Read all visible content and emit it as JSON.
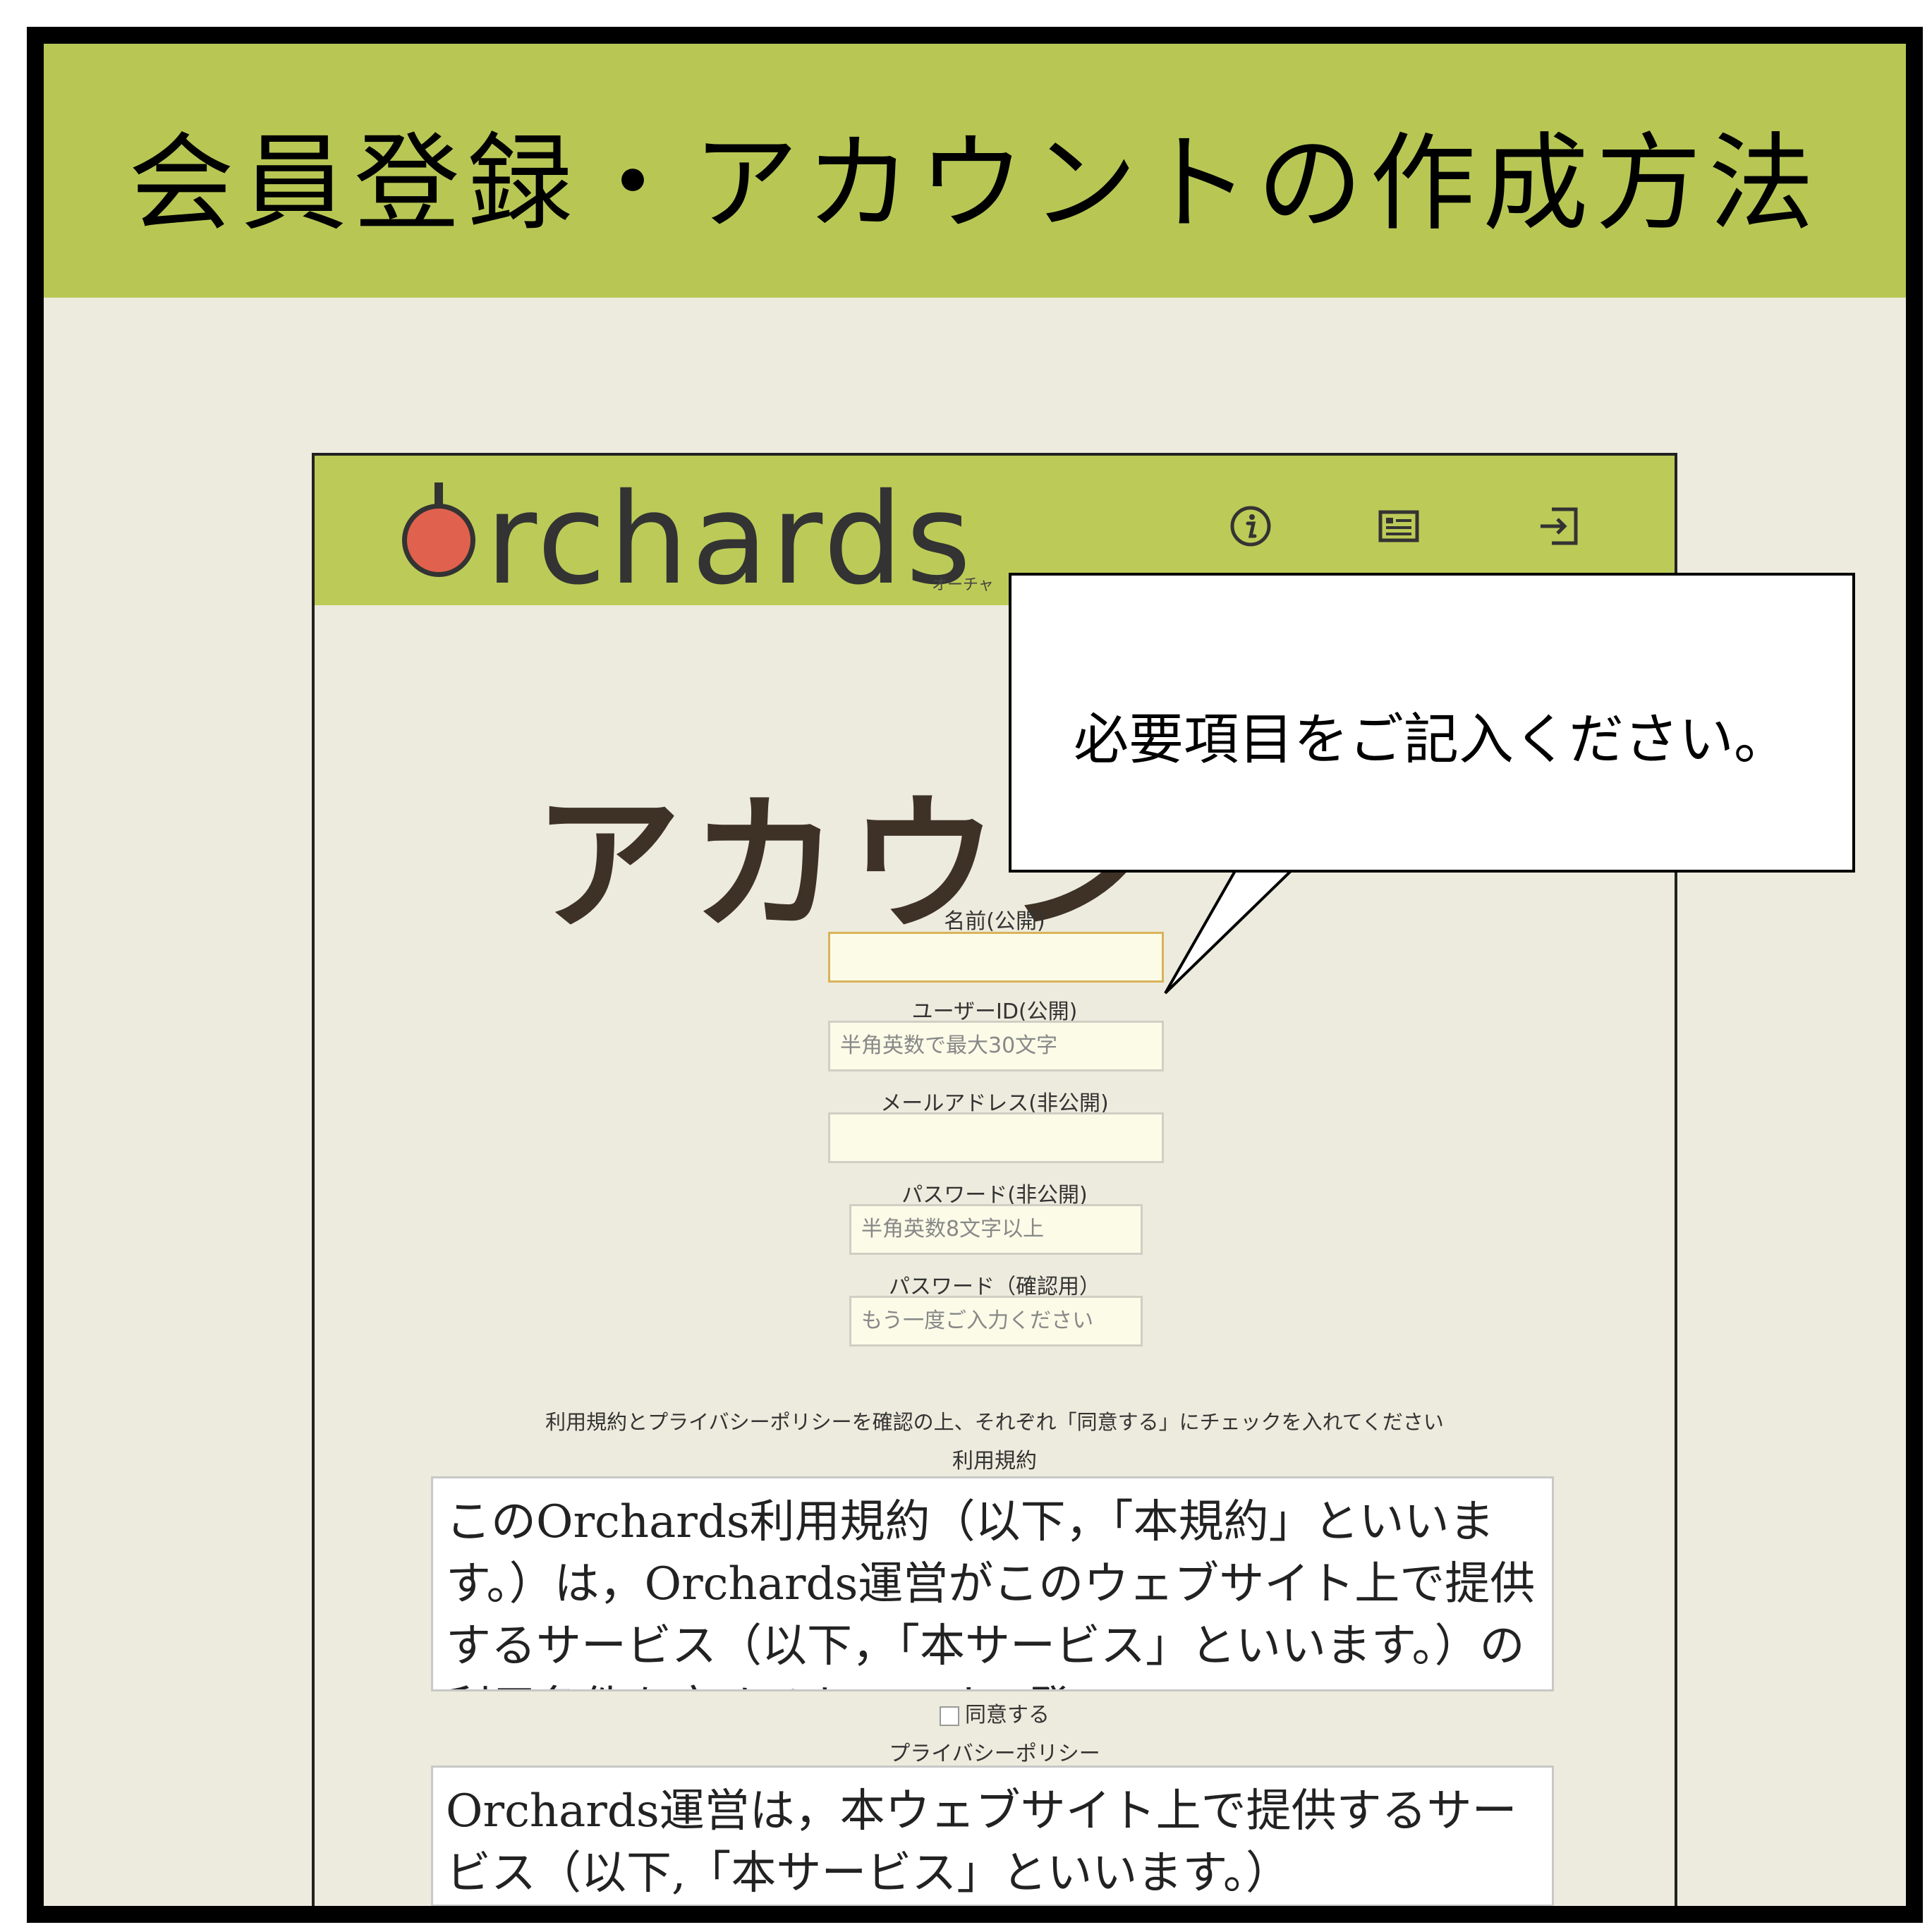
{
  "heading": "会員登録・アカウントの作成方法",
  "header": {
    "logo_text": "rchards",
    "tagline": "オーチャ",
    "icons": [
      "info-icon",
      "list-icon",
      "login-icon"
    ]
  },
  "page_title": "アカウン",
  "form": {
    "name_label": "名前(公開)",
    "name_value": "",
    "userid_label": "ユーザーID(公開)",
    "userid_placeholder": "半角英数で最大30文字",
    "email_label": "メールアドレス(非公開)",
    "email_value": "",
    "password_label": "パスワード(非公開)",
    "password_placeholder": "半角英数8文字以上",
    "password_confirm_label": "パスワード（確認用）",
    "password_confirm_placeholder": "もう一度ご入力ください"
  },
  "notice": "利用規約とプライバシーポリシーを確認の上、それぞれ「同意する」にチェックを入れてください",
  "terms": {
    "label": "利用規約",
    "text": "このOrchards利用規約（以下，「本規約」といいます。）は，Orchards運営がこのウェブサイト上で提供するサービス（以下，「本サービス」といいます。）の利用条件を定めるものです。登",
    "agree_label": "同意する"
  },
  "privacy": {
    "label": "プライバシーポリシー",
    "text": "Orchards運営は，本ウェブサイト上で提供するサービス（以下,「本サービス」といいます。）"
  },
  "callout": {
    "text": "必要項目をご記入ください。"
  },
  "colors": {
    "band": "#b8c754",
    "background": "#edebdd",
    "logo_dot": "#e0614d",
    "title_text": "#3e3226"
  }
}
